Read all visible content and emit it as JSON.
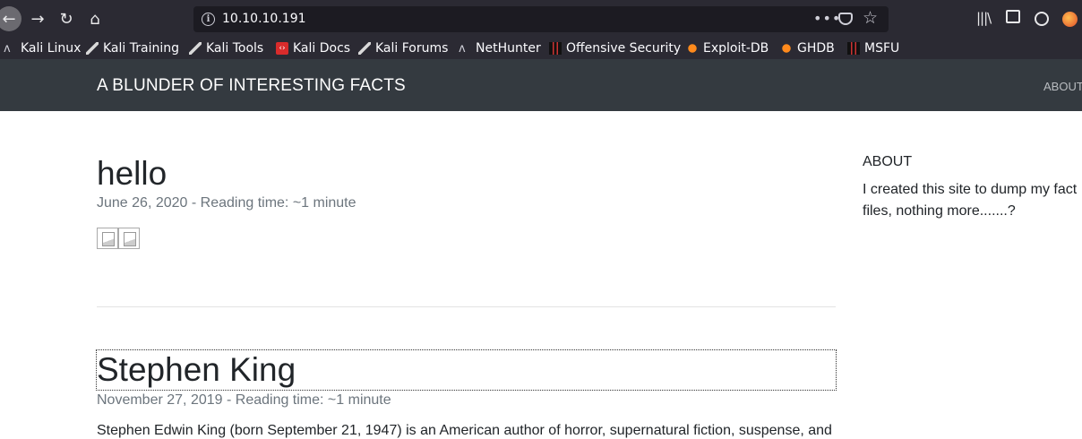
{
  "browser": {
    "url": "10.10.10.191",
    "bookmarks": [
      {
        "label": "Kali Linux",
        "icon": "kali-dragon-icon"
      },
      {
        "label": "Kali Training",
        "icon": "kali-knife-icon"
      },
      {
        "label": "Kali Tools",
        "icon": "kali-knife-icon"
      },
      {
        "label": "Kali Docs",
        "icon": "kali-docs-icon"
      },
      {
        "label": "Kali Forums",
        "icon": "kali-knife-icon"
      },
      {
        "label": "NetHunter",
        "icon": "kali-dragon-icon"
      },
      {
        "label": "Offensive Security",
        "icon": "offsec-icon"
      },
      {
        "label": "Exploit-DB",
        "icon": "exploit-db-icon"
      },
      {
        "label": "GHDB",
        "icon": "exploit-db-icon"
      },
      {
        "label": "MSFU",
        "icon": "offsec-icon"
      }
    ]
  },
  "site": {
    "brand": "A BLUNDER OF INTERESTING FACTS",
    "nav_about": "ABOUT"
  },
  "posts": [
    {
      "title": "hello",
      "date": "June 26, 2020",
      "reading_time": "- Reading time: ~1 minute"
    },
    {
      "title": "Stephen King",
      "date": "November 27, 2019",
      "reading_time": "- Reading time: ~1 minute",
      "excerpt": "Stephen Edwin King (born September 21, 1947) is an American author of horror, supernatural fiction, suspense, and"
    }
  ],
  "sidebar": {
    "about_heading": "ABOUT",
    "about_text": "I created this site to dump my fact files, nothing more.......?"
  },
  "colors": {
    "browser_chrome": "#2b2a33",
    "site_header": "#343a40",
    "text_muted": "#6c757d"
  }
}
